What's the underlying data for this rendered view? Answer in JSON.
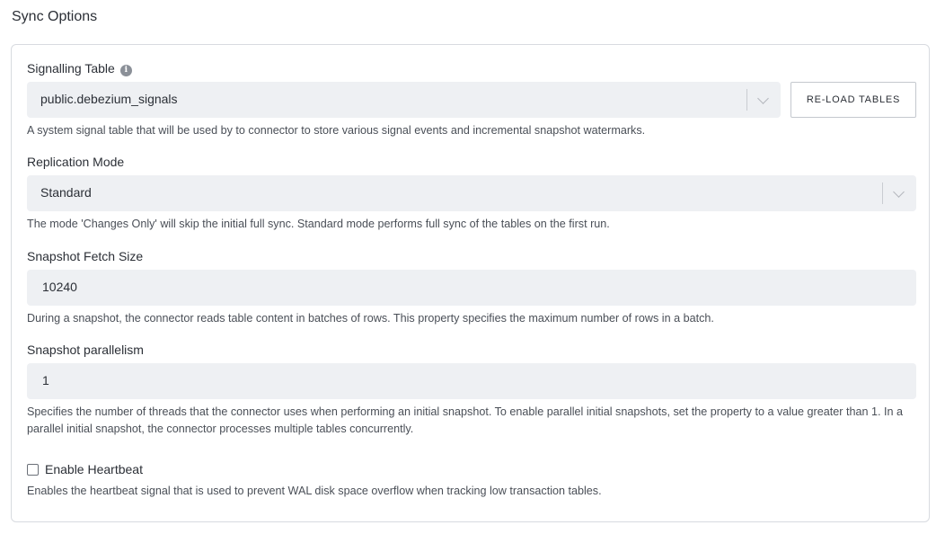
{
  "section": {
    "title": "Sync Options"
  },
  "signalling_table": {
    "label": "Signalling Table",
    "info_icon": "info-icon",
    "value": "public.debezium_signals",
    "reload_button": "RE-LOAD TABLES",
    "help": "A system signal table that will be used by to connector to store various signal events and incremental snapshot watermarks."
  },
  "replication_mode": {
    "label": "Replication Mode",
    "value": "Standard",
    "help": "The mode 'Changes Only' will skip the initial full sync. Standard mode performs full sync of the tables on the first run."
  },
  "snapshot_fetch_size": {
    "label": "Snapshot Fetch Size",
    "value": "10240",
    "help": "During a snapshot, the connector reads table content in batches of rows. This property specifies the maximum number of rows in a batch."
  },
  "snapshot_parallelism": {
    "label": "Snapshot parallelism",
    "value": "1",
    "help": "Specifies the number of threads that the connector uses when performing an initial snapshot. To enable parallel initial snapshots, set the property to a value greater than 1. In a parallel initial snapshot, the connector processes multiple tables concurrently."
  },
  "heartbeat": {
    "label": "Enable Heartbeat",
    "checked": false,
    "help": "Enables the heartbeat signal that is used to prevent WAL disk space overflow when tracking low transaction tables."
  }
}
